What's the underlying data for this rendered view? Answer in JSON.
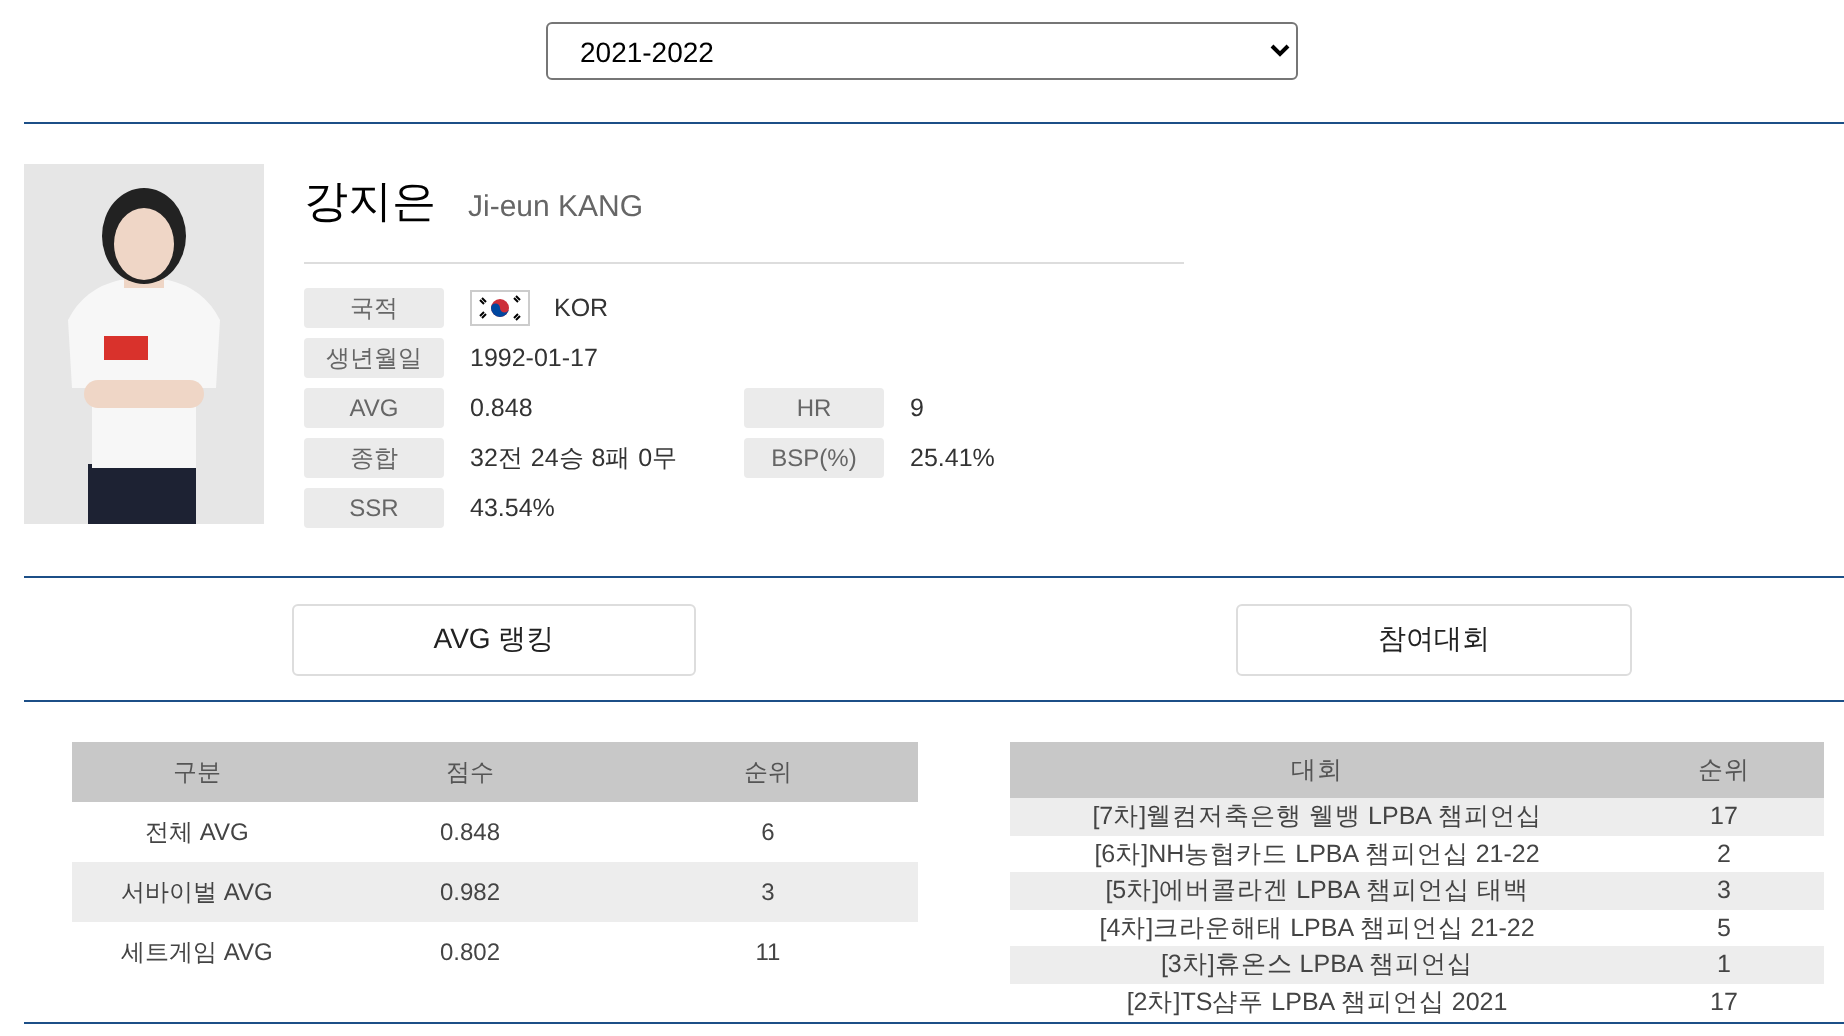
{
  "season_select": {
    "value": "2021-2022"
  },
  "player": {
    "name_ko": "강지은",
    "name_en": "Ji-eun KANG"
  },
  "info": [
    [
      {
        "label": "국적",
        "value": "KOR",
        "kind": "flag"
      }
    ],
    [
      {
        "label": "생년월일",
        "value": "1992-01-17",
        "kind": "text"
      }
    ],
    [
      {
        "label": "AVG",
        "value": "0.848",
        "kind": "text"
      },
      {
        "label": "HR",
        "value": "9",
        "kind": "text"
      }
    ],
    [
      {
        "label": "종합",
        "value": "32전 24승 8패 0무",
        "kind": "text"
      },
      {
        "label": "BSP(%)",
        "value": "25.41%",
        "kind": "text"
      }
    ],
    [
      {
        "label": "SSR",
        "value": "43.54%",
        "kind": "text"
      }
    ]
  ],
  "buttons": [
    {
      "label": "AVG 랭킹"
    },
    {
      "label": "참여대회"
    }
  ],
  "avg_table": {
    "columns": [
      "구분",
      "점수",
      "순위"
    ],
    "rows": [
      [
        "전체 AVG",
        "0.848",
        "6"
      ],
      [
        "서바이벌 AVG",
        "0.982",
        "3"
      ],
      [
        "세트게임 AVG",
        "0.802",
        "11"
      ]
    ]
  },
  "events_table": {
    "columns": [
      "대회",
      "순위"
    ],
    "rows": [
      [
        "[7차]웰컴저축은행 웰뱅 LPBA 챔피언십",
        "17"
      ],
      [
        "[6차]NH농협카드 LPBA 챔피언십 21-22",
        "2"
      ],
      [
        "[5차]에버콜라겐 LPBA 챔피언십 태백",
        "3"
      ],
      [
        "[4차]크라운해태 LPBA 챔피언십 21-22",
        "5"
      ],
      [
        "[3차]휴온스 LPBA 챔피언십",
        "1"
      ],
      [
        "[2차]TS샴푸 LPBA 챔피언십 2021",
        "17"
      ]
    ]
  }
}
